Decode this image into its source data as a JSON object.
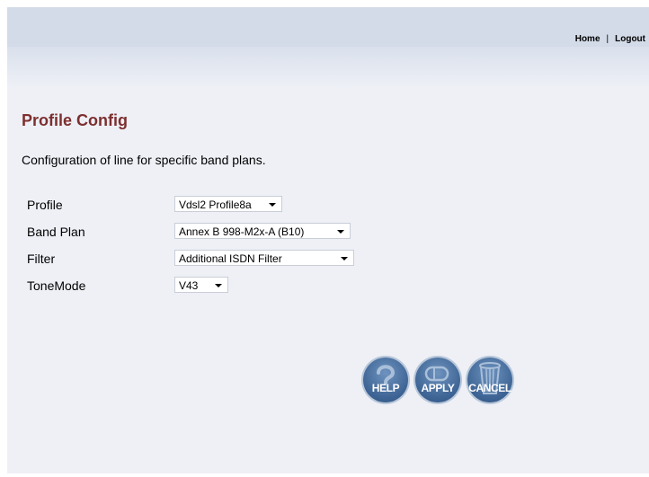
{
  "nav": {
    "home": "Home",
    "separator": "|",
    "logout": "Logout"
  },
  "page": {
    "title": "Profile Config",
    "description": "Configuration of line for specific band plans."
  },
  "form": {
    "profile": {
      "label": "Profile",
      "value": "Vdsl2 Profile8a"
    },
    "band_plan": {
      "label": "Band Plan",
      "value": "Annex B 998-M2x-A (B10)"
    },
    "filter": {
      "label": "Filter",
      "value": "Additional ISDN Filter"
    },
    "tone_mode": {
      "label": "ToneMode",
      "value": "V43"
    }
  },
  "buttons": {
    "help": {
      "label": "HELP",
      "icon": "question-icon"
    },
    "apply": {
      "label": "APPLY",
      "icon": "apply-icon"
    },
    "cancel": {
      "label": "CANCEL",
      "icon": "trash-icon"
    }
  },
  "colors": {
    "title": "#7d2f2f",
    "header_bar": "#d3dbe8",
    "background": "#eef0f6",
    "button": "#3f6696"
  }
}
